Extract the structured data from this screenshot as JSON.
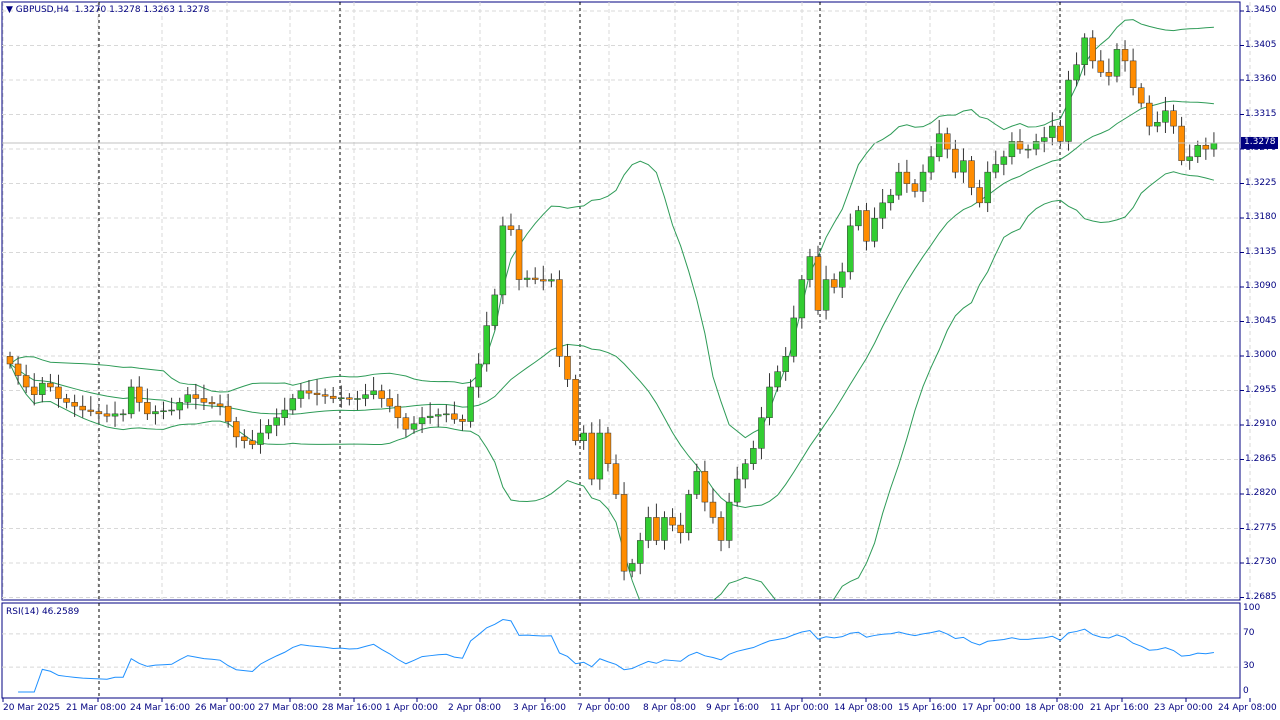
{
  "header": {
    "symbol": "GBPUSD,H4",
    "open": "1.3270",
    "high": "1.3278",
    "low": "1.3263",
    "close": "1.3278"
  },
  "current_price": "1.3278",
  "price_axis": [
    "1.3450",
    "1.3405",
    "1.3360",
    "1.3315",
    "1.3270",
    "1.3225",
    "1.3180",
    "1.3135",
    "1.3090",
    "1.3045",
    "1.3000",
    "1.2955",
    "1.2910",
    "1.2865",
    "1.2820",
    "1.2775",
    "1.2730",
    "1.2685"
  ],
  "rsi": {
    "label": "RSI(14) 46.2589",
    "levels": [
      "100",
      "70",
      "30",
      "0"
    ]
  },
  "time_axis": [
    "20 Mar 2025",
    "21 Mar 08:00",
    "24 Mar 16:00",
    "26 Mar 00:00",
    "27 Mar 08:00",
    "28 Mar 16:00",
    "1 Apr 00:00",
    "2 Apr 08:00",
    "3 Apr 16:00",
    "7 Apr 00:00",
    "8 Apr 08:00",
    "9 Apr 16:00",
    "11 Apr 00:00",
    "14 Apr 08:00",
    "15 Apr 16:00",
    "17 Apr 00:00",
    "18 Apr 08:00",
    "21 Apr 16:00",
    "23 Apr 00:00",
    "24 Apr 08:00"
  ],
  "colors": {
    "bull": "#32cd32",
    "bear": "#ff8c00",
    "band": "#2e9b57",
    "rsi": "#1e90ff",
    "axis": "#000080",
    "grid": "#d8d8d8"
  },
  "chart_data": {
    "type": "candlestick",
    "ylim": [
      1.2685,
      1.345
    ],
    "closes": [
      1.299,
      1.2975,
      1.296,
      1.295,
      1.2965,
      1.296,
      1.2945,
      1.294,
      1.2935,
      1.293,
      1.2928,
      1.2925,
      1.2922,
      1.2925,
      1.2925,
      1.296,
      1.294,
      1.2925,
      1.2928,
      1.2929,
      1.293,
      1.294,
      1.295,
      1.2945,
      1.294,
      1.2938,
      1.2935,
      1.2915,
      1.2895,
      1.289,
      1.2885,
      1.29,
      1.291,
      1.292,
      1.293,
      1.2945,
      1.2955,
      1.2952,
      1.295,
      1.2948,
      1.2945,
      1.2946,
      1.2944,
      1.2945,
      1.295,
      1.2955,
      1.2945,
      1.2935,
      1.292,
      1.2905,
      1.2912,
      1.292,
      1.2922,
      1.2924,
      1.2925,
      1.2918,
      1.2915,
      1.296,
      1.299,
      1.304,
      1.308,
      1.317,
      1.3165,
      1.31,
      1.3102,
      1.31,
      1.3098,
      1.31,
      1.3,
      1.297,
      1.289,
      1.29,
      1.284,
      1.29,
      1.286,
      1.282,
      1.272,
      1.273,
      1.276,
      1.279,
      1.276,
      1.279,
      1.278,
      1.277,
      1.282,
      1.285,
      1.281,
      1.279,
      1.276,
      1.281,
      1.284,
      1.286,
      1.288,
      1.292,
      1.296,
      1.298,
      1.3,
      1.305,
      1.31,
      1.313,
      1.306,
      1.31,
      1.309,
      1.311,
      1.317,
      1.319,
      1.315,
      1.318,
      1.32,
      1.321,
      1.324,
      1.3225,
      1.3215,
      1.324,
      1.326,
      1.329,
      1.327,
      1.324,
      1.3255,
      1.322,
      1.32,
      1.324,
      1.325,
      1.326,
      1.328,
      1.327,
      1.327,
      1.328,
      1.3285,
      1.33,
      1.328,
      1.336,
      1.338,
      1.3415,
      1.3385,
      1.337,
      1.3365,
      1.34,
      1.3385,
      1.335,
      1.333,
      1.33,
      1.3305,
      1.332,
      1.33,
      1.3255,
      1.326,
      1.3275,
      1.327,
      1.3278
    ]
  }
}
